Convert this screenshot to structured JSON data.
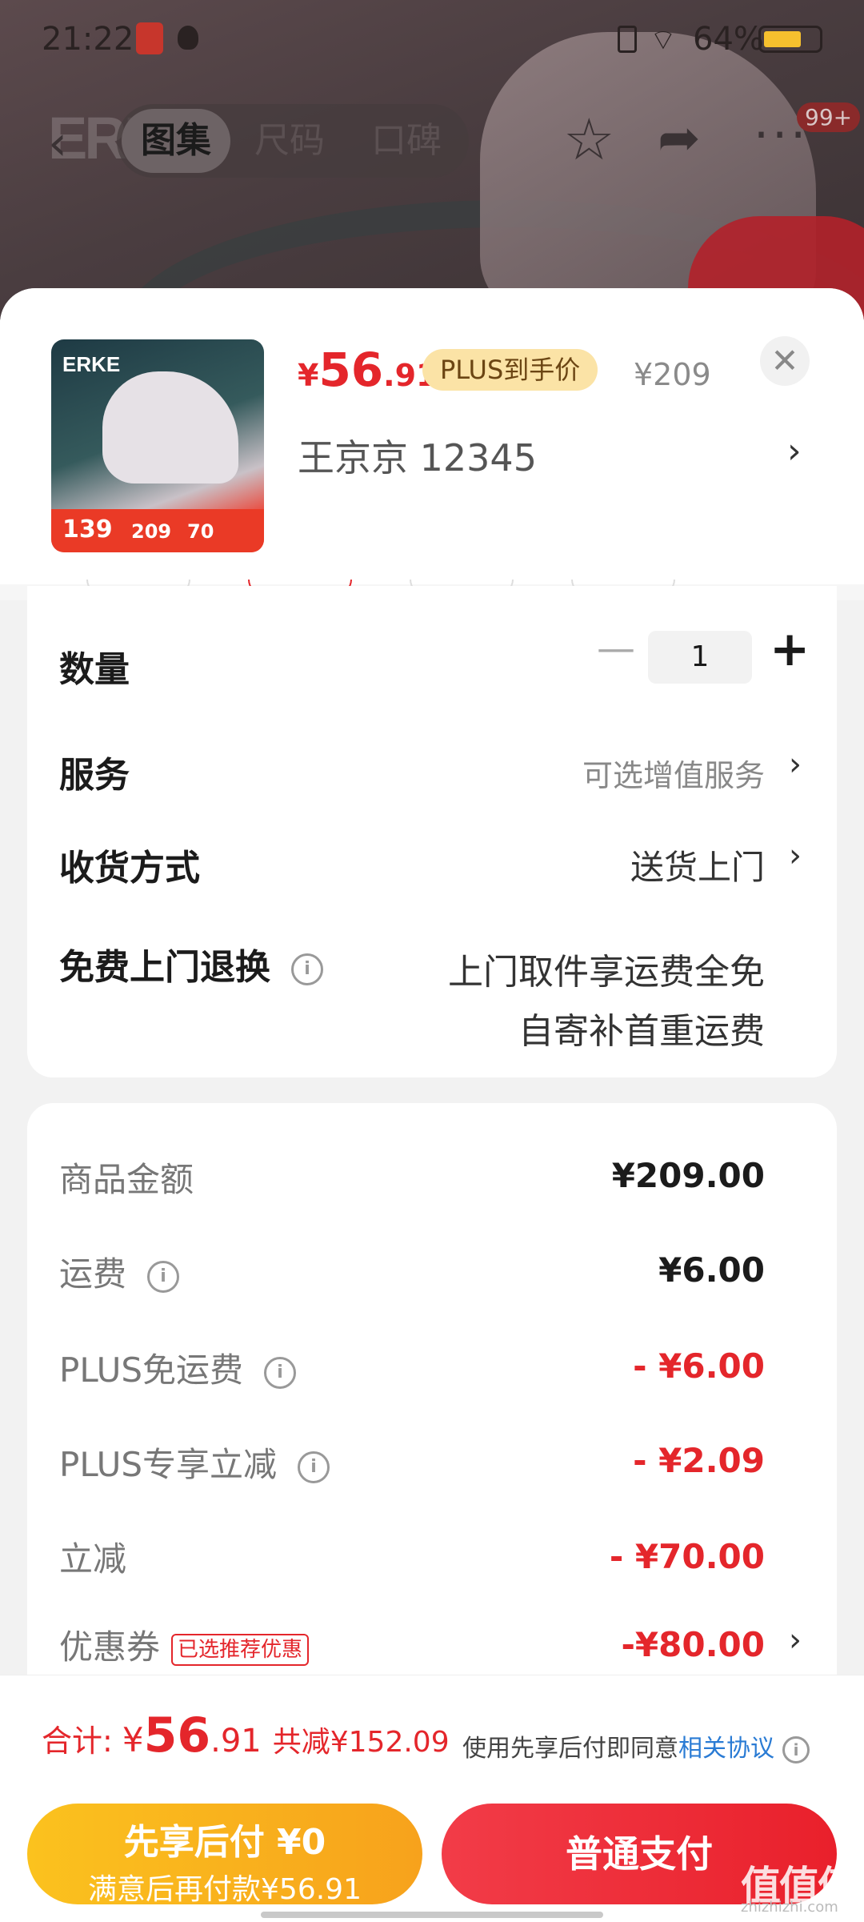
{
  "status_bar": {
    "time": "21:22",
    "battery": "64%"
  },
  "nav": {
    "tabs": [
      "图集",
      "尺码",
      "口碑"
    ],
    "badge": "99+"
  },
  "sku": {
    "thumb_brand": "ERKE",
    "thumb_price": "139",
    "thumb_mid": "209",
    "thumb_mid2": "70",
    "price_yen": "¥",
    "price_int": "56",
    "price_dec": ".91",
    "plus_tag": "PLUS到手价",
    "original_price": "¥209",
    "address": "王京京  12345"
  },
  "options": {
    "quantity_label": "数量",
    "quantity_value": "1",
    "service_label": "服务",
    "service_value": "可选增值服务",
    "delivery_label": "收货方式",
    "delivery_value": "送货上门",
    "return_label": "免费上门退换",
    "return_line1": "上门取件享运费全免",
    "return_line2": "自寄补首重运费"
  },
  "fees": [
    {
      "label": "商品金额",
      "value": "¥209.00",
      "red": false,
      "info": false
    },
    {
      "label": "运费",
      "value": "¥6.00",
      "red": false,
      "info": true
    },
    {
      "label": "PLUS免运费",
      "value": "- ¥6.00",
      "red": true,
      "info": true
    },
    {
      "label": "PLUS专享立减",
      "value": "- ¥2.09",
      "red": true,
      "info": true
    },
    {
      "label": "立减",
      "value": "- ¥70.00",
      "red": true,
      "info": false
    },
    {
      "label": "优惠券",
      "value": "-¥80.00",
      "red": true,
      "info": false,
      "tag": "已选推荐优惠"
    }
  ],
  "footer": {
    "total_label": "合计: ",
    "total_yen": "¥",
    "total_int": "56",
    "total_dec": ".91",
    "saved": "共减¥152.09",
    "agree_text": "使用先享后付即同意",
    "agree_link": "相关协议",
    "later_line1": "先享后付 ¥0",
    "later_line2": "满意后再付款¥56.91",
    "pay_label": "普通支付"
  },
  "watermark": {
    "text": "值值值",
    "sub": "zhizhizhi.com"
  },
  "colors": {
    "accent_red": "#e4262b",
    "gold": "#f7a21c",
    "link_blue": "#2a7bd4"
  }
}
